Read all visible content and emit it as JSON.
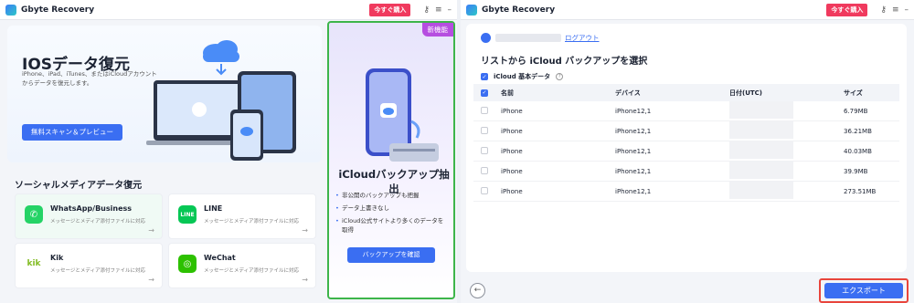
{
  "left": {
    "app_title": "Gbyte Recovery",
    "buy_label": "今すぐ購入",
    "ios": {
      "title": "IOSデータ復元",
      "desc": "iPhone、iPad、iTunes、またはiCloudアカウントからデータを復元します。",
      "scan_button": "無料スキャン＆プレビュー"
    },
    "social_title": "ソーシャルメディアデータ復元",
    "apps": [
      {
        "name": "WhatsApp/Business",
        "desc": "メッセージとメディア添付ファイルに対応",
        "color": "#25d366"
      },
      {
        "name": "LINE",
        "desc": "メッセージとメディア添付ファイルに対応",
        "color": "#06c755"
      },
      {
        "name": "Kik",
        "desc": "メッセージとメディア添付ファイルに対応",
        "color": "#82bc23"
      },
      {
        "name": "WeChat",
        "desc": "メッセージとメディア添付ファイルに対応",
        "color": "#2dc100"
      }
    ],
    "icloud": {
      "badge": "新機能",
      "title": "iCloudバックアップ抽出",
      "features": [
        "非公開のバックアップも把握",
        "データ上書きなし",
        "iCloud公式サイトより多くのデータを取得"
      ],
      "button": "バックアップを確認"
    }
  },
  "right": {
    "app_title": "Gbyte Recovery",
    "buy_label": "今すぐ購入",
    "logout": "ログアウト",
    "list_title": "リストから iCloud バックアップを選択",
    "basic_data": "iCloud 基本データ",
    "columns": [
      "名前",
      "デバイス",
      "日付(UTC)",
      "サイズ"
    ],
    "rows": [
      {
        "name": "iPhone",
        "device": "iPhone12,1",
        "size": "6.79MB"
      },
      {
        "name": "iPhone",
        "device": "iPhone12,1",
        "size": "36.21MB"
      },
      {
        "name": "iPhone",
        "device": "iPhone12,1",
        "size": "40.03MB"
      },
      {
        "name": "iPhone",
        "device": "iPhone12,1",
        "size": "39.9MB"
      },
      {
        "name": "iPhone",
        "device": "iPhone12,1",
        "size": "273.51MB"
      }
    ],
    "export_button": "エクスポート"
  }
}
